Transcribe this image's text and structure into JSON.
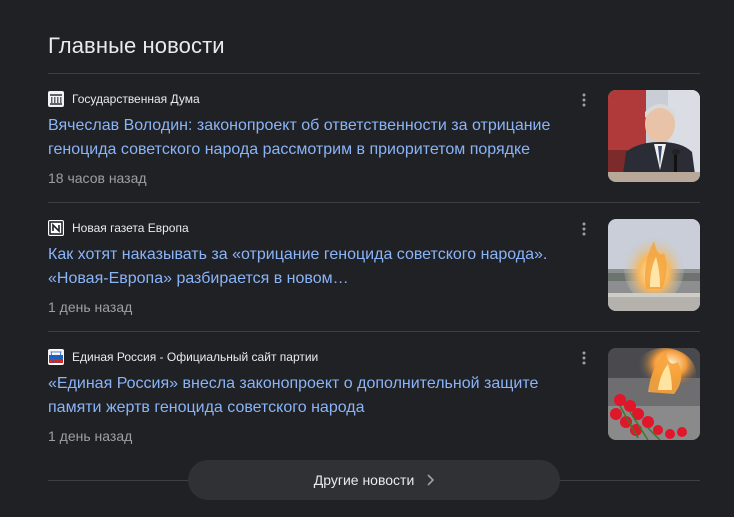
{
  "section": {
    "title": "Главные новости"
  },
  "articles": [
    {
      "source": "Государственная Дума",
      "source_icon": "duma-favicon-icon",
      "headline": "Вячеслав Володин: законопроект об ответственности за отрицание геноцида советского народа рассмотрим в приоритетом порядке",
      "time": "18 часов назад",
      "thumbnail": "speaker-at-microphone-photo"
    },
    {
      "source": "Новая газета Европа",
      "source_icon": "novaya-gazeta-favicon-icon",
      "headline": "Как хотят наказывать за «отрицание геноцида советского народа». «Новая-Европа» разбирается в новом…",
      "time": "1 день назад",
      "thumbnail": "eternal-flame-photo"
    },
    {
      "source": "Единая Россия - Официальный сайт партии",
      "source_icon": "edinaya-rossiya-favicon-icon",
      "headline": "«Единая Россия» внесла законопроект о дополнительной защите памяти жертв геноцида советского народа",
      "time": "1 день назад",
      "thumbnail": "flame-with-red-carnations-photo"
    }
  ],
  "footer": {
    "more_label": "Другие новости"
  },
  "colors": {
    "background": "#202124",
    "link": "#8ab4f8",
    "text": "#e8eaed",
    "secondary": "#9aa0a6",
    "divider": "#3c4043",
    "button_bg": "#303134"
  }
}
